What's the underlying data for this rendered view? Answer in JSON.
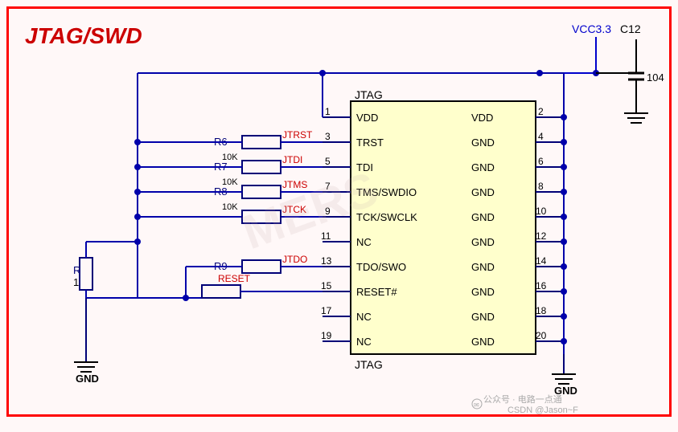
{
  "title": "JTAG/SWD",
  "vcc_label": "VCC3.3",
  "c12_label": "C12",
  "cap_value": "104",
  "ic": {
    "top_label": "JTAG",
    "bottom_label": "JTAG",
    "left_pins": [
      {
        "name": "VDD",
        "num": "1"
      },
      {
        "name": "TRST",
        "num": "3"
      },
      {
        "name": "TDI",
        "num": "5"
      },
      {
        "name": "TMS/SWDIO",
        "num": "7"
      },
      {
        "name": "TCK/SWCLK",
        "num": "9"
      },
      {
        "name": "NC",
        "num": "11"
      },
      {
        "name": "TDO/SWO",
        "num": "13"
      },
      {
        "name": "RESET#",
        "num": "15"
      },
      {
        "name": "NC",
        "num": "17"
      },
      {
        "name": "NC",
        "num": "19"
      }
    ],
    "right_pins": [
      {
        "name": "VDD",
        "num": "2"
      },
      {
        "name": "GND",
        "num": "4"
      },
      {
        "name": "GND",
        "num": "6"
      },
      {
        "name": "GND",
        "num": "8"
      },
      {
        "name": "GND",
        "num": "10"
      },
      {
        "name": "GND",
        "num": "12"
      },
      {
        "name": "GND",
        "num": "14"
      },
      {
        "name": "GND",
        "num": "16"
      },
      {
        "name": "GND",
        "num": "18"
      },
      {
        "name": "GND",
        "num": "20"
      }
    ]
  },
  "resistors": [
    {
      "label": "R6",
      "value": ""
    },
    {
      "label": "R7",
      "value": "10K"
    },
    {
      "label": "R8",
      "value": "10K"
    },
    {
      "label": "R9",
      "value": ""
    },
    {
      "label": "R10",
      "value": "10K"
    }
  ],
  "net_labels": [
    "JTRST",
    "JTDI",
    "JTMS",
    "JTCK",
    "JTDO",
    "RESET"
  ],
  "gnd_label": "GND",
  "watermark_line1": "公众号 · 电路一点通",
  "watermark_line2": "CSDN @Jason~F"
}
